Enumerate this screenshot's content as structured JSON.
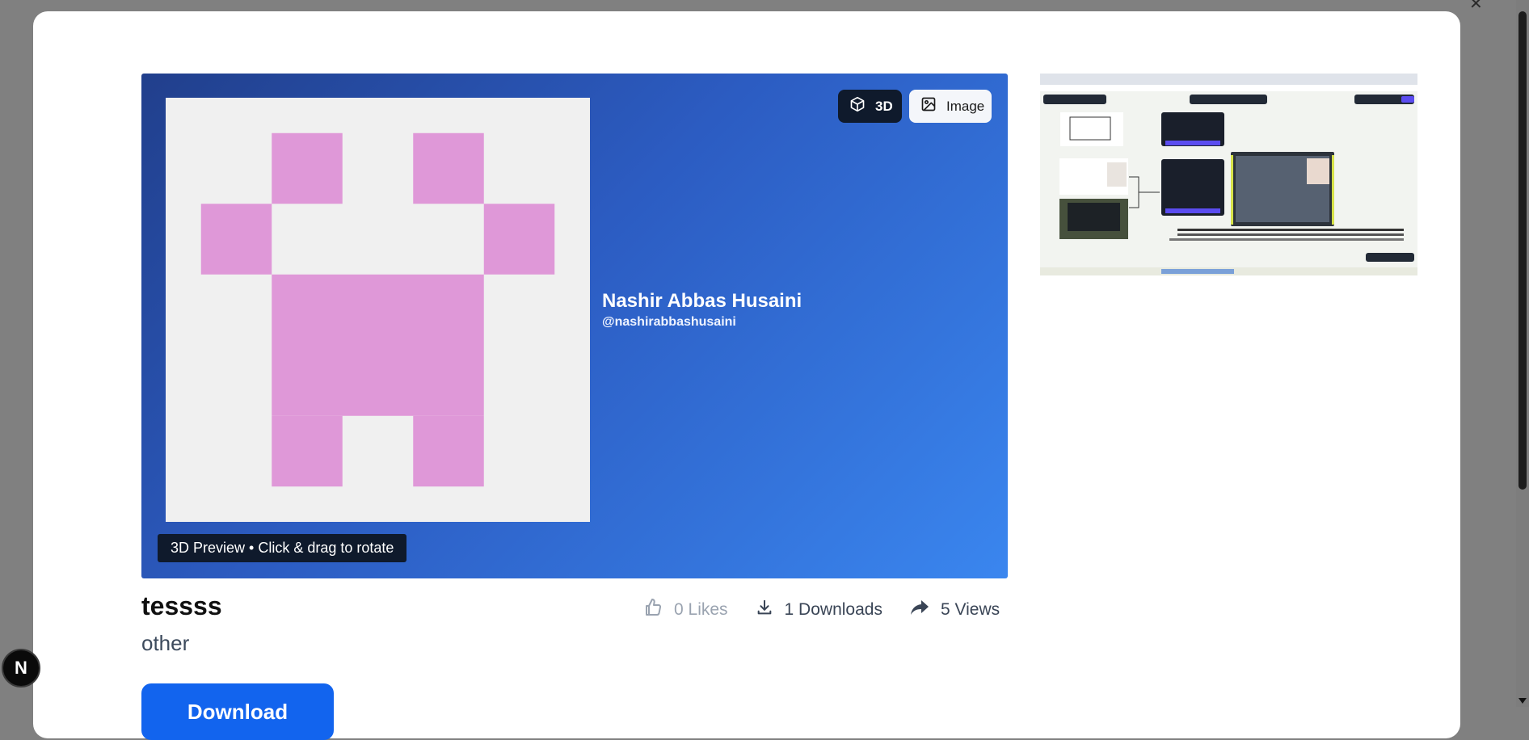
{
  "preview": {
    "mode_3d_label": "3D",
    "mode_image_label": "Image",
    "hint_text": "3D Preview • Click & drag to rotate",
    "pixel_color": "#df98d8",
    "canvas_bg": "#f0f0f0"
  },
  "author": {
    "name": "Nashir Abbas Husaini",
    "handle": "@nashirabbashusaini"
  },
  "item": {
    "title": "tessss",
    "category": "other"
  },
  "stats": {
    "likes": "0 Likes",
    "downloads": "1 Downloads",
    "views": "5 Views"
  },
  "actions": {
    "download_label": "Download"
  },
  "badge": {
    "letter": "N"
  },
  "icons": [
    "cube-icon",
    "image-icon",
    "thumbs-up-icon",
    "download-icon",
    "share-arrow-icon"
  ],
  "colors": {
    "accent": "#1264ee",
    "dark_chip": "#0f1a2c",
    "backdrop": "#808080"
  }
}
